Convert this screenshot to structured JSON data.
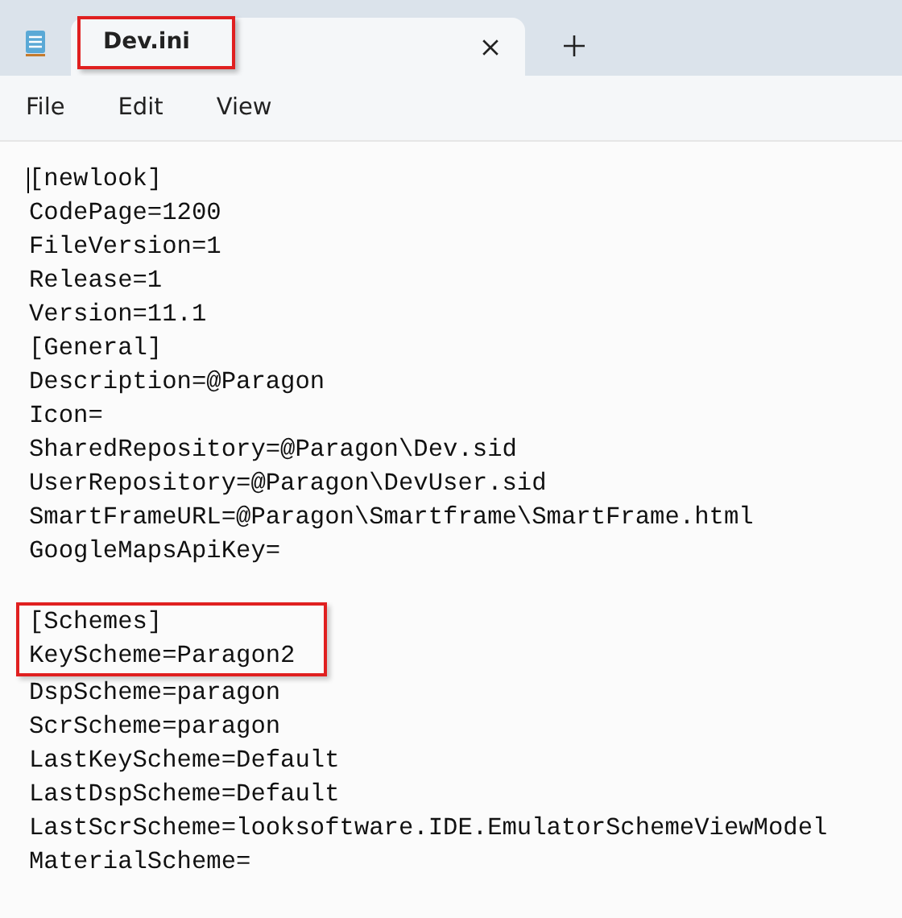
{
  "tabs": [
    {
      "title": "Dev.ini",
      "selected": true,
      "highlighted": true
    }
  ],
  "menu": [
    "File",
    "Edit",
    "View"
  ],
  "editor": {
    "lines": [
      {
        "kind": "text",
        "text": "[newlook]",
        "highlighted": false,
        "caret": true
      },
      {
        "kind": "text",
        "text": "CodePage=1200",
        "highlighted": false,
        "caret": false
      },
      {
        "kind": "text",
        "text": "FileVersion=1",
        "highlighted": false,
        "caret": false
      },
      {
        "kind": "text",
        "text": "Release=1",
        "highlighted": false,
        "caret": false
      },
      {
        "kind": "text",
        "text": "Version=11.1",
        "highlighted": false,
        "caret": false
      },
      {
        "kind": "text",
        "text": "[General]",
        "highlighted": false,
        "caret": false
      },
      {
        "kind": "text",
        "text": "Description=@Paragon",
        "highlighted": false,
        "caret": false
      },
      {
        "kind": "text",
        "text": "Icon=",
        "highlighted": false,
        "caret": false
      },
      {
        "kind": "text",
        "text": "SharedRepository=@Paragon\\Dev.sid",
        "highlighted": false,
        "caret": false
      },
      {
        "kind": "text",
        "text": "UserRepository=@Paragon\\DevUser.sid",
        "highlighted": false,
        "caret": false
      },
      {
        "kind": "text",
        "text": "SmartFrameURL=@Paragon\\Smartframe\\SmartFrame.html",
        "highlighted": false,
        "caret": false
      },
      {
        "kind": "text",
        "text": "GoogleMapsApiKey=",
        "highlighted": false,
        "caret": false
      },
      {
        "kind": "blank"
      },
      {
        "kind": "text",
        "text": "[Schemes]",
        "highlighted": true,
        "caret": false
      },
      {
        "kind": "text",
        "text": "KeyScheme=Paragon2",
        "highlighted": true,
        "caret": false
      },
      {
        "kind": "text",
        "text": "DspScheme=paragon",
        "highlighted": false,
        "caret": false
      },
      {
        "kind": "text",
        "text": "ScrScheme=paragon",
        "highlighted": false,
        "caret": false
      },
      {
        "kind": "text",
        "text": "LastKeyScheme=Default",
        "highlighted": false,
        "caret": false
      },
      {
        "kind": "text",
        "text": "LastDspScheme=Default",
        "highlighted": false,
        "caret": false
      },
      {
        "kind": "text",
        "text": "LastScrScheme=looksoftware.IDE.EmulatorSchemeViewModel",
        "highlighted": false,
        "caret": false
      },
      {
        "kind": "text",
        "text": "MaterialScheme=",
        "highlighted": false,
        "caret": false
      }
    ]
  }
}
